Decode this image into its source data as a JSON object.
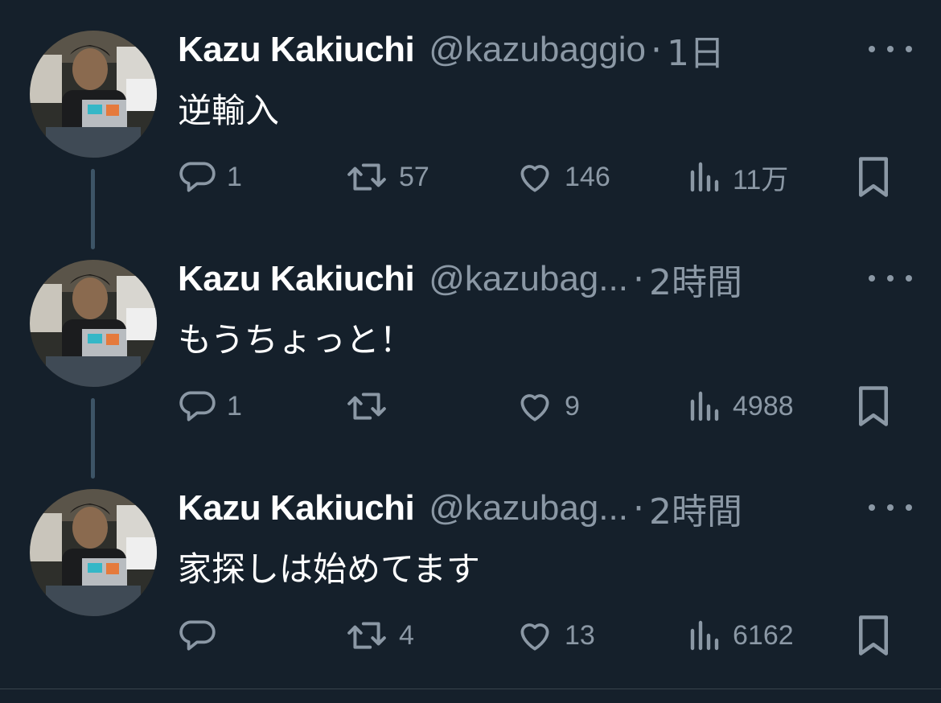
{
  "tweets": [
    {
      "name": "Kazu Kakiuchi",
      "handle": "@kazubaggio",
      "separator": "·",
      "time": "1日",
      "text": "逆輸入",
      "replies": "1",
      "retweets": "57",
      "likes": "146",
      "views": "11万"
    },
    {
      "name": "Kazu Kakiuchi",
      "handle": "@kazubag...",
      "separator": "·",
      "time": "2時間",
      "text": "もうちょっと！",
      "replies": "1",
      "retweets": "",
      "likes": "9",
      "views": "4988"
    },
    {
      "name": "Kazu Kakiuchi",
      "handle": "@kazubag...",
      "separator": "·",
      "time": "2時間",
      "text": "家探しは始めてます",
      "replies": "",
      "retweets": "4",
      "likes": "13",
      "views": "6162"
    }
  ],
  "icons": {
    "reply": "reply-icon",
    "retweet": "retweet-icon",
    "like": "heart-icon",
    "views": "views-icon",
    "bookmark": "bookmark-icon",
    "more": "more-icon"
  },
  "colors": {
    "background": "#15202b",
    "primary_text": "#ffffff",
    "secondary_text": "#8b98a5",
    "thread_line": "#3d5466"
  }
}
